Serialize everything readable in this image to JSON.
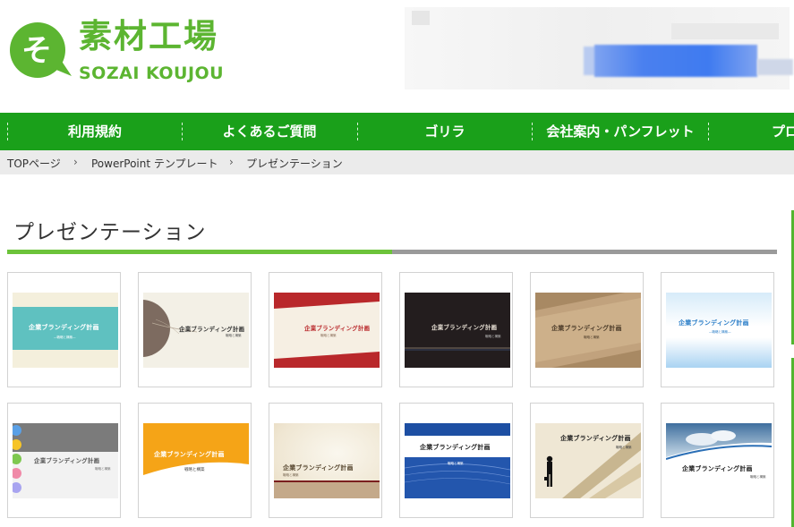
{
  "site": {
    "logo_mark": "そ",
    "logo_jp": "素材工場",
    "logo_en": "SOZAI KOUJOU",
    "brand_green": "#5cb531",
    "nav_green": "#1aa01a"
  },
  "nav": {
    "items": [
      {
        "label": "利用規約"
      },
      {
        "label": "よくあるご質問"
      },
      {
        "label": "ゴリラ"
      },
      {
        "label": "会社案内・パンフレット"
      },
      {
        "label": "プロ"
      }
    ]
  },
  "breadcrumb": {
    "items": [
      {
        "label": "TOPページ"
      },
      {
        "label": "PowerPoint テンプレート"
      },
      {
        "label": "プレゼンテーション"
      }
    ],
    "separator": "›"
  },
  "page": {
    "title": "プレゼンテーション"
  },
  "templates": [
    {
      "title": "企業ブランディング計画",
      "sub": "―戦略と構築―"
    },
    {
      "title": "企業ブランディング計画",
      "sub": "戦略と構築"
    },
    {
      "title": "企業ブランディング計画",
      "sub": "戦略と構築"
    },
    {
      "title": "企業ブランディング計画",
      "sub": "戦略と構築"
    },
    {
      "title": "企業ブランディング計画",
      "sub": "戦略と構築"
    },
    {
      "title": "企業ブランディング計画",
      "sub": "―戦略と構築―"
    },
    {
      "title": "企業ブランディング計画",
      "sub": "戦略と構築"
    },
    {
      "title": "企業ブランディング計画",
      "sub": "戦略と構築"
    },
    {
      "title": "企業ブランディング計画",
      "sub": "戦略と構築"
    },
    {
      "title": "企業ブランディング計画",
      "sub": "戦略と構築"
    },
    {
      "title": "企業ブランディング計画",
      "sub": "戦略と構築"
    },
    {
      "title": "企業ブランディング計画",
      "sub": "戦略と構築"
    }
  ]
}
